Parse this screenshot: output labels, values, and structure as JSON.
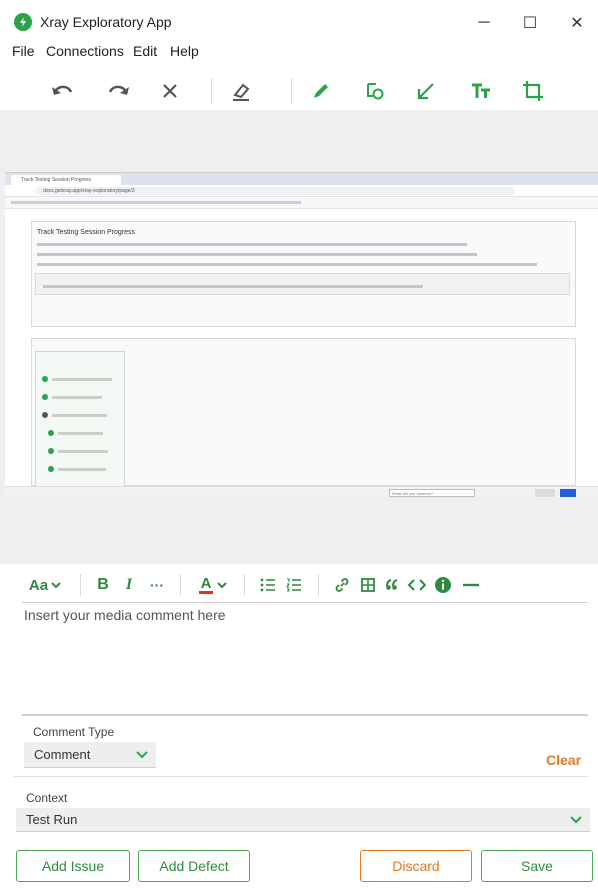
{
  "window": {
    "title": "Xray Exploratory App",
    "minimize_glyph": "─",
    "maximize_glyph": "☐",
    "close_glyph": "✕"
  },
  "menu": {
    "items": [
      "File",
      "Connections",
      "Edit",
      "Help"
    ]
  },
  "toolbar": {
    "icons": [
      "undo-icon",
      "redo-icon",
      "delete-icon",
      "eraser-icon",
      "pen-icon",
      "shape-icon",
      "arrow-icon",
      "text-icon",
      "crop-icon"
    ],
    "accent_color": "#2aa34a",
    "gray_color": "#555555"
  },
  "screenshot": {
    "tab_title": "Track Testing Session Progress",
    "url": "docs.getxray.app/xray-exploratory/page/3",
    "section_heading": "Track Testing Session Progress",
    "bottom_input_placeholder": "What did you observe?"
  },
  "rich_text_toolbar": {
    "font_label": "Aa",
    "bold": "B",
    "italic": "I",
    "more": "···",
    "text_color_label": "A"
  },
  "comment": {
    "placeholder": "Insert your media comment here"
  },
  "comment_type": {
    "label": "Comment Type",
    "value": "Comment"
  },
  "clear_label": "Clear",
  "context": {
    "label": "Context",
    "value": "Test Run"
  },
  "buttons": {
    "add_issue": "Add Issue",
    "add_defect": "Add Defect",
    "discard": "Discard",
    "save": "Save"
  }
}
